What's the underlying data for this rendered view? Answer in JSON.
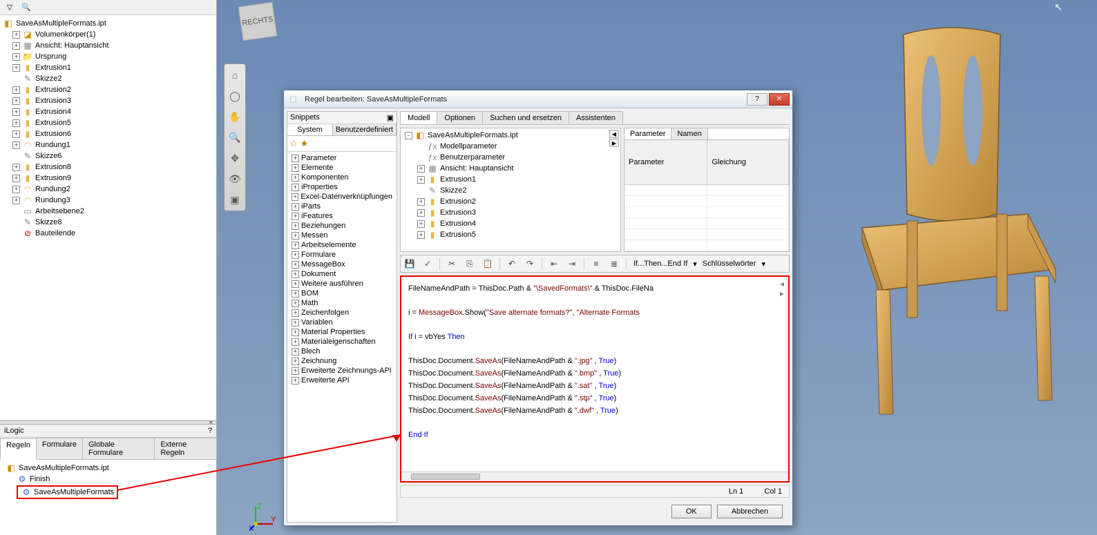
{
  "browser": {
    "root": "SaveAsMultipleFormats.ipt",
    "items": [
      {
        "icon": "body",
        "label": "Volumenkörper(1)",
        "exp": "+",
        "indent": 1
      },
      {
        "icon": "view",
        "label": "Ansicht: Hauptansicht",
        "exp": "+",
        "indent": 1
      },
      {
        "icon": "folder",
        "label": "Ursprung",
        "exp": "+",
        "indent": 1
      },
      {
        "icon": "ext",
        "label": "Extrusion1",
        "exp": "+",
        "indent": 1
      },
      {
        "icon": "sketch",
        "label": "Skizze2",
        "exp": "",
        "indent": 1
      },
      {
        "icon": "ext",
        "label": "Extrusion2",
        "exp": "+",
        "indent": 1
      },
      {
        "icon": "ext",
        "label": "Extrusion3",
        "exp": "+",
        "indent": 1
      },
      {
        "icon": "ext",
        "label": "Extrusion4",
        "exp": "+",
        "indent": 1
      },
      {
        "icon": "ext",
        "label": "Extrusion5",
        "exp": "+",
        "indent": 1
      },
      {
        "icon": "ext",
        "label": "Extrusion6",
        "exp": "+",
        "indent": 1
      },
      {
        "icon": "round",
        "label": "Rundung1",
        "exp": "+",
        "indent": 1
      },
      {
        "icon": "sketch",
        "label": "Skizze6",
        "exp": "",
        "indent": 1
      },
      {
        "icon": "ext",
        "label": "Extrusion8",
        "exp": "+",
        "indent": 1
      },
      {
        "icon": "ext",
        "label": "Extrusion9",
        "exp": "+",
        "indent": 1
      },
      {
        "icon": "round",
        "label": "Rundung2",
        "exp": "+",
        "indent": 1
      },
      {
        "icon": "round",
        "label": "Rundung3",
        "exp": "+",
        "indent": 1
      },
      {
        "icon": "plane",
        "label": "Arbeitsebene2",
        "exp": "",
        "indent": 1
      },
      {
        "icon": "sketch",
        "label": "Skizze8",
        "exp": "",
        "indent": 1
      },
      {
        "icon": "end",
        "label": "Bauteilende",
        "exp": "",
        "indent": 1
      }
    ]
  },
  "ilogic": {
    "header": "iLogic",
    "tabs": [
      "Regeln",
      "Formulare",
      "Globale Formulare",
      "Externe Regeln"
    ],
    "root": "SaveAsMultipleFormats.ipt",
    "rules": [
      "Finish",
      "SaveAsMultipleFormats"
    ]
  },
  "dialog": {
    "title": "Regel bearbeiten: SaveAsMultipleFormats",
    "snippets": {
      "header": "Snippets",
      "tabs": [
        "System",
        "Benutzerdefiniert"
      ],
      "items": [
        "Parameter",
        "Elemente",
        "Komponenten",
        "iProperties",
        "Excel-Datenverknüpfungen",
        "iParts",
        "iFeatures",
        "Beziehungen",
        "Messen",
        "Arbeitselemente",
        "Formulare",
        "MessageBox",
        "Dokument",
        "Weitere ausführen",
        "BOM",
        "Math",
        "Zeichenfolgen",
        "Variablen",
        "Material Properties",
        "Materialeigenschaften",
        "Blech",
        "Zeichnung",
        "Erweiterte Zeichnungs-API",
        "Erweiterte API"
      ]
    },
    "main_tabs": [
      "Modell",
      "Optionen",
      "Suchen und ersetzen",
      "Assistenten"
    ],
    "model_tree": [
      {
        "icon": "part",
        "label": "SaveAsMultipleFormats.ipt",
        "exp": "-",
        "indent": 0
      },
      {
        "icon": "fx",
        "label": "Modellparameter",
        "exp": "",
        "indent": 1
      },
      {
        "icon": "fx",
        "label": "Benutzerparameter",
        "exp": "",
        "indent": 1
      },
      {
        "icon": "view",
        "label": "Ansicht: Hauptansicht",
        "exp": "+",
        "indent": 1
      },
      {
        "icon": "ext",
        "label": "Extrusion1",
        "exp": "+",
        "indent": 1
      },
      {
        "icon": "sketch",
        "label": "Skizze2",
        "exp": "",
        "indent": 1
      },
      {
        "icon": "ext",
        "label": "Extrusion2",
        "exp": "+",
        "indent": 1
      },
      {
        "icon": "ext",
        "label": "Extrusion3",
        "exp": "+",
        "indent": 1
      },
      {
        "icon": "ext",
        "label": "Extrusion4",
        "exp": "+",
        "indent": 1
      },
      {
        "icon": "ext",
        "label": "Extrusion5",
        "exp": "+",
        "indent": 1
      }
    ],
    "param_tabs": [
      "Parameter",
      "Namen"
    ],
    "param_cols": [
      "Parameter",
      "Gleichung"
    ],
    "toolbar_txt": {
      "ifthen": "If...Then...End If",
      "keywords": "Schlüsselwörter"
    },
    "status": {
      "ln": "Ln 1",
      "col": "Col 1"
    },
    "buttons": {
      "ok": "OK",
      "cancel": "Abbrechen"
    },
    "code_lines": [
      [
        {
          "c": "norm",
          "t": "FileNameAndPath = ThisDoc.Path & "
        },
        {
          "c": "str",
          "t": "\"\\SavedFormats\\\""
        },
        {
          "c": "norm",
          "t": " & ThisDoc.FileNa"
        }
      ],
      [],
      [
        {
          "c": "norm",
          "t": "i = "
        },
        {
          "c": "id",
          "t": "MessageBox"
        },
        {
          "c": "norm",
          "t": ".Show("
        },
        {
          "c": "str",
          "t": "\"Save alternate formats?\""
        },
        {
          "c": "norm",
          "t": ", "
        },
        {
          "c": "str",
          "t": "\"Alternate Formats "
        }
      ],
      [],
      [
        {
          "c": "kw",
          "t": "If"
        },
        {
          "c": "norm",
          "t": " i = vbYes "
        },
        {
          "c": "kw",
          "t": "Then"
        }
      ],
      [],
      [
        {
          "c": "norm",
          "t": "ThisDoc.Document."
        },
        {
          "c": "id",
          "t": "SaveAs"
        },
        {
          "c": "norm",
          "t": "(FileNameAndPath & "
        },
        {
          "c": "str",
          "t": "\".jpg\""
        },
        {
          "c": "norm",
          "t": " , "
        },
        {
          "c": "kw",
          "t": "True"
        },
        {
          "c": "norm",
          "t": ")"
        }
      ],
      [
        {
          "c": "norm",
          "t": "ThisDoc.Document."
        },
        {
          "c": "id",
          "t": "SaveAs"
        },
        {
          "c": "norm",
          "t": "(FileNameAndPath & "
        },
        {
          "c": "str",
          "t": "\".bmp\""
        },
        {
          "c": "norm",
          "t": " , "
        },
        {
          "c": "kw",
          "t": "True"
        },
        {
          "c": "norm",
          "t": ")"
        }
      ],
      [
        {
          "c": "norm",
          "t": "ThisDoc.Document."
        },
        {
          "c": "id",
          "t": "SaveAs"
        },
        {
          "c": "norm",
          "t": "(FileNameAndPath & "
        },
        {
          "c": "str",
          "t": "\".sat\""
        },
        {
          "c": "norm",
          "t": " , "
        },
        {
          "c": "kw",
          "t": "True"
        },
        {
          "c": "norm",
          "t": ")"
        }
      ],
      [
        {
          "c": "norm",
          "t": "ThisDoc.Document."
        },
        {
          "c": "id",
          "t": "SaveAs"
        },
        {
          "c": "norm",
          "t": "(FileNameAndPath & "
        },
        {
          "c": "str",
          "t": "\".stp\""
        },
        {
          "c": "norm",
          "t": " , "
        },
        {
          "c": "kw",
          "t": "True"
        },
        {
          "c": "norm",
          "t": ")"
        }
      ],
      [
        {
          "c": "norm",
          "t": "ThisDoc.Document."
        },
        {
          "c": "id",
          "t": "SaveAs"
        },
        {
          "c": "norm",
          "t": "(FileNameAndPath & "
        },
        {
          "c": "str",
          "t": "\".dwf\""
        },
        {
          "c": "norm",
          "t": " , "
        },
        {
          "c": "kw",
          "t": "True"
        },
        {
          "c": "norm",
          "t": ")"
        }
      ],
      [],
      [
        {
          "c": "kw",
          "t": "End If"
        }
      ]
    ]
  },
  "navcube": "RECHTS"
}
